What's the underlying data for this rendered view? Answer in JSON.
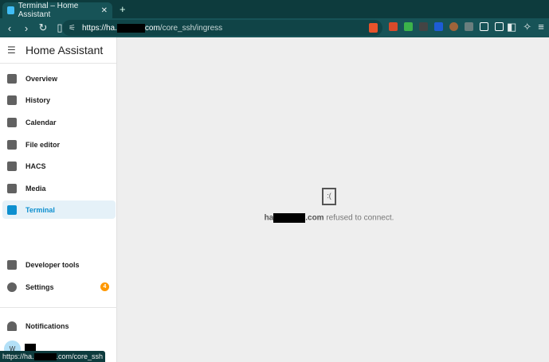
{
  "browser": {
    "tab_title": "Terminal – Home Assistant",
    "url_host_start": "https://ha.",
    "url_host_end": "com",
    "url_path": "/core_ssh/ingress",
    "status_url_start": "https://ha.",
    "status_url_end": ".com/core_ssh"
  },
  "sidebar": {
    "title": "Home Assistant",
    "items": [
      {
        "label": "Overview",
        "icon": "view-dashboard-icon"
      },
      {
        "label": "History",
        "icon": "chart-box-icon"
      },
      {
        "label": "Calendar",
        "icon": "calendar-icon"
      },
      {
        "label": "File editor",
        "icon": "wrench-icon"
      },
      {
        "label": "HACS",
        "icon": "hacs-icon"
      },
      {
        "label": "Media",
        "icon": "play-box-multiple-icon"
      },
      {
        "label": "Terminal",
        "icon": "console-icon",
        "active": true
      }
    ],
    "bottom": [
      {
        "label": "Developer tools",
        "icon": "hammer-icon"
      },
      {
        "label": "Settings",
        "icon": "cog-icon",
        "badge": "4"
      }
    ],
    "notifications": "Notifications",
    "avatar_initial": "W"
  },
  "error": {
    "host_start": "ha",
    "host_end": ".com",
    "message": " refused to connect."
  },
  "colors": {
    "accent": "#0d8fcf",
    "badge": "#ff9800"
  }
}
